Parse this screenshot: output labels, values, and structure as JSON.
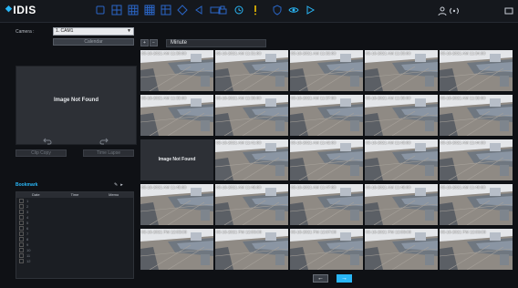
{
  "app": {
    "logo": "IDIS"
  },
  "colors": {
    "accent": "#29b6f6",
    "toolbar_icon": "#2a66c8",
    "background": "#0f1115"
  },
  "toolbar": {
    "layout_icons": [
      "single-view-icon",
      "grid-2x2-icon",
      "grid-3x3-icon",
      "grid-4x4-icon",
      "grid-custom-icon",
      "diamond-icon",
      "back-icon",
      "rect-icon"
    ],
    "mode_icons": [
      "printer-icon",
      "refresh-icon",
      "alarm-icon",
      "shield-icon",
      "eye-icon",
      "play-icon"
    ],
    "right_icons": [
      "person-icon",
      "audio-icon",
      "window-icon"
    ]
  },
  "camera": {
    "label": "Camera :",
    "selected": "1. CAM1"
  },
  "calendar_label": "Calendar",
  "preview": {
    "not_found": "Image Not Found"
  },
  "clip_copy_label": "Clip Copy",
  "time_lapse_label": "Time Lapse",
  "bookmark": {
    "title": "Bookmark",
    "columns": [
      "Date",
      "Time",
      "Memo"
    ],
    "rows": [
      "1",
      "2",
      "3",
      "4",
      "5",
      "6",
      "7",
      "8",
      "9",
      "10",
      "11",
      "12"
    ]
  },
  "timeline": {
    "unit": "Minute"
  },
  "thumbnails": [
    "03-16-2021  AM 11:30:00",
    "03-16-2021  AM 11:31:00",
    "03-16-2021  AM 11:32:00",
    "03-16-2021  AM 11:33:00",
    "03-16-2021  AM 11:34:00",
    "03-16-2021  AM 11:35:00",
    "03-16-2021  AM 11:36:00",
    "03-16-2021  AM 11:37:00",
    "03-16-2021  AM 11:38:00",
    "03-16-2021  AM 11:39:00",
    "",
    "03-16-2021  AM 11:41:00",
    "03-16-2021  AM 11:42:00",
    "03-16-2021  AM 11:43:00",
    "03-16-2021  AM 11:44:00",
    "03-16-2021  AM 11:45:00",
    "03-16-2021  AM 11:46:00",
    "03-16-2021  AM 11:47:00",
    "03-16-2021  AM 11:48:00",
    "03-16-2021  AM 11:49:00",
    "03-16-2021  PM 12:05:00",
    "03-16-2021  PM 12:06:00",
    "03-16-2021  PM 12:07:00",
    "03-16-2021  PM 12:08:00",
    "03-16-2021  PM 12:09:00"
  ],
  "grid_not_found": "Image Not Found",
  "nav": {
    "prev": "←",
    "next": "→"
  }
}
